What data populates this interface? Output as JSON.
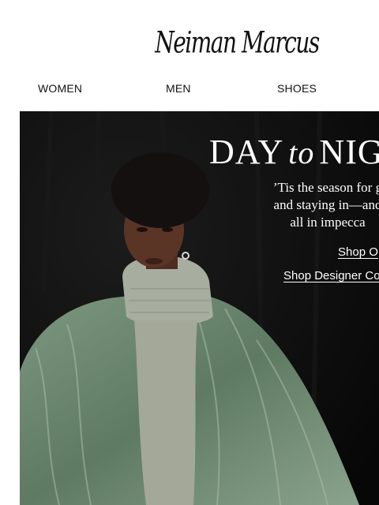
{
  "brand": {
    "logo_text": "Neiman Marcus"
  },
  "nav": {
    "items": [
      {
        "label": "WOMEN"
      },
      {
        "label": "MEN"
      },
      {
        "label": "SHOES"
      }
    ]
  },
  "hero": {
    "headline_part1": "DAY",
    "headline_to": "to",
    "headline_part2": "NIG",
    "subcopy_lines": [
      "’Tis the season for g",
      "and staying in—and",
      "all in impecca"
    ],
    "cta_primary": "Shop O",
    "cta_secondary": "Shop Designer Co"
  },
  "colors": {
    "hero_background": "#0b0b0b",
    "coat": "#6f8a72",
    "sweater": "#a8ae9f",
    "skin": "#5a3526",
    "hair": "#141010"
  }
}
